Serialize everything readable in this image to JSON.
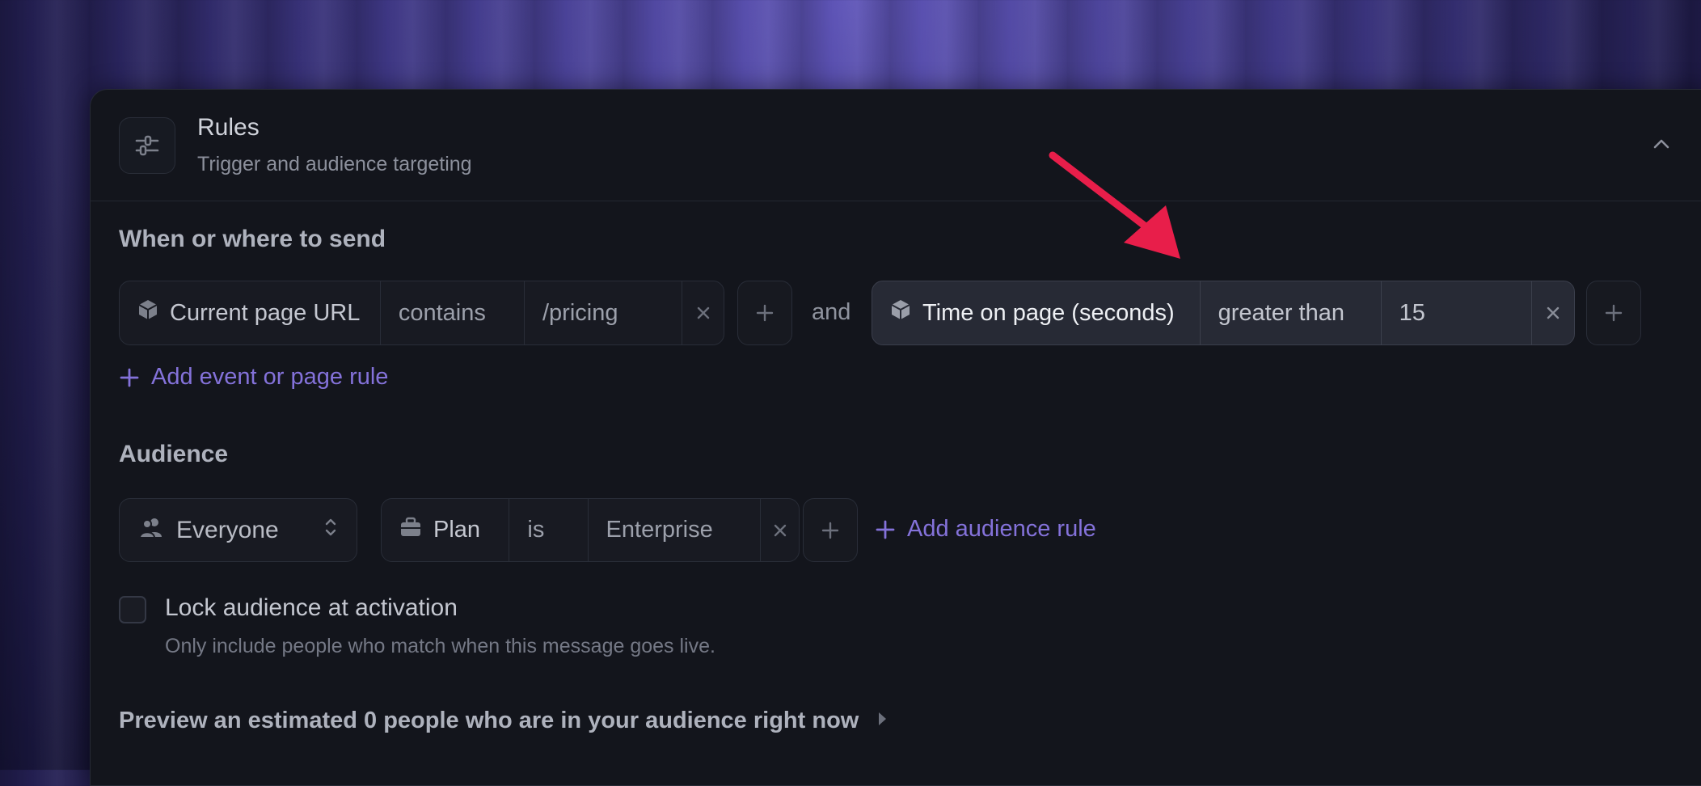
{
  "header": {
    "title": "Rules",
    "subtitle": "Trigger and audience targeting",
    "icon": "sliders-icon",
    "collapse_icon": "chevron-up-icon"
  },
  "when": {
    "title": "When or where to send",
    "rule1": {
      "field": "Current page URL",
      "operator": "contains",
      "value": "/pricing",
      "icon": "cube-icon"
    },
    "conjunction": "and",
    "rule2": {
      "field": "Time on page (seconds)",
      "operator": "greater than",
      "value": "15",
      "icon": "cube-icon"
    },
    "add_link": "Add event or page rule"
  },
  "audience": {
    "title": "Audience",
    "selector": {
      "value": "Everyone",
      "icon": "users-icon"
    },
    "rule": {
      "field": "Plan",
      "operator": "is",
      "value": "Enterprise",
      "icon": "briefcase-icon"
    },
    "add_link": "Add audience rule"
  },
  "lock": {
    "label": "Lock audience at activation",
    "help": "Only include people who match when this message goes live.",
    "checked": false
  },
  "preview": {
    "text": "Preview an estimated 0 people who are in your audience right now"
  },
  "colors": {
    "accent": "#8472da",
    "annotation_arrow": "#e81e4a",
    "panel_bg": "#13151c"
  }
}
